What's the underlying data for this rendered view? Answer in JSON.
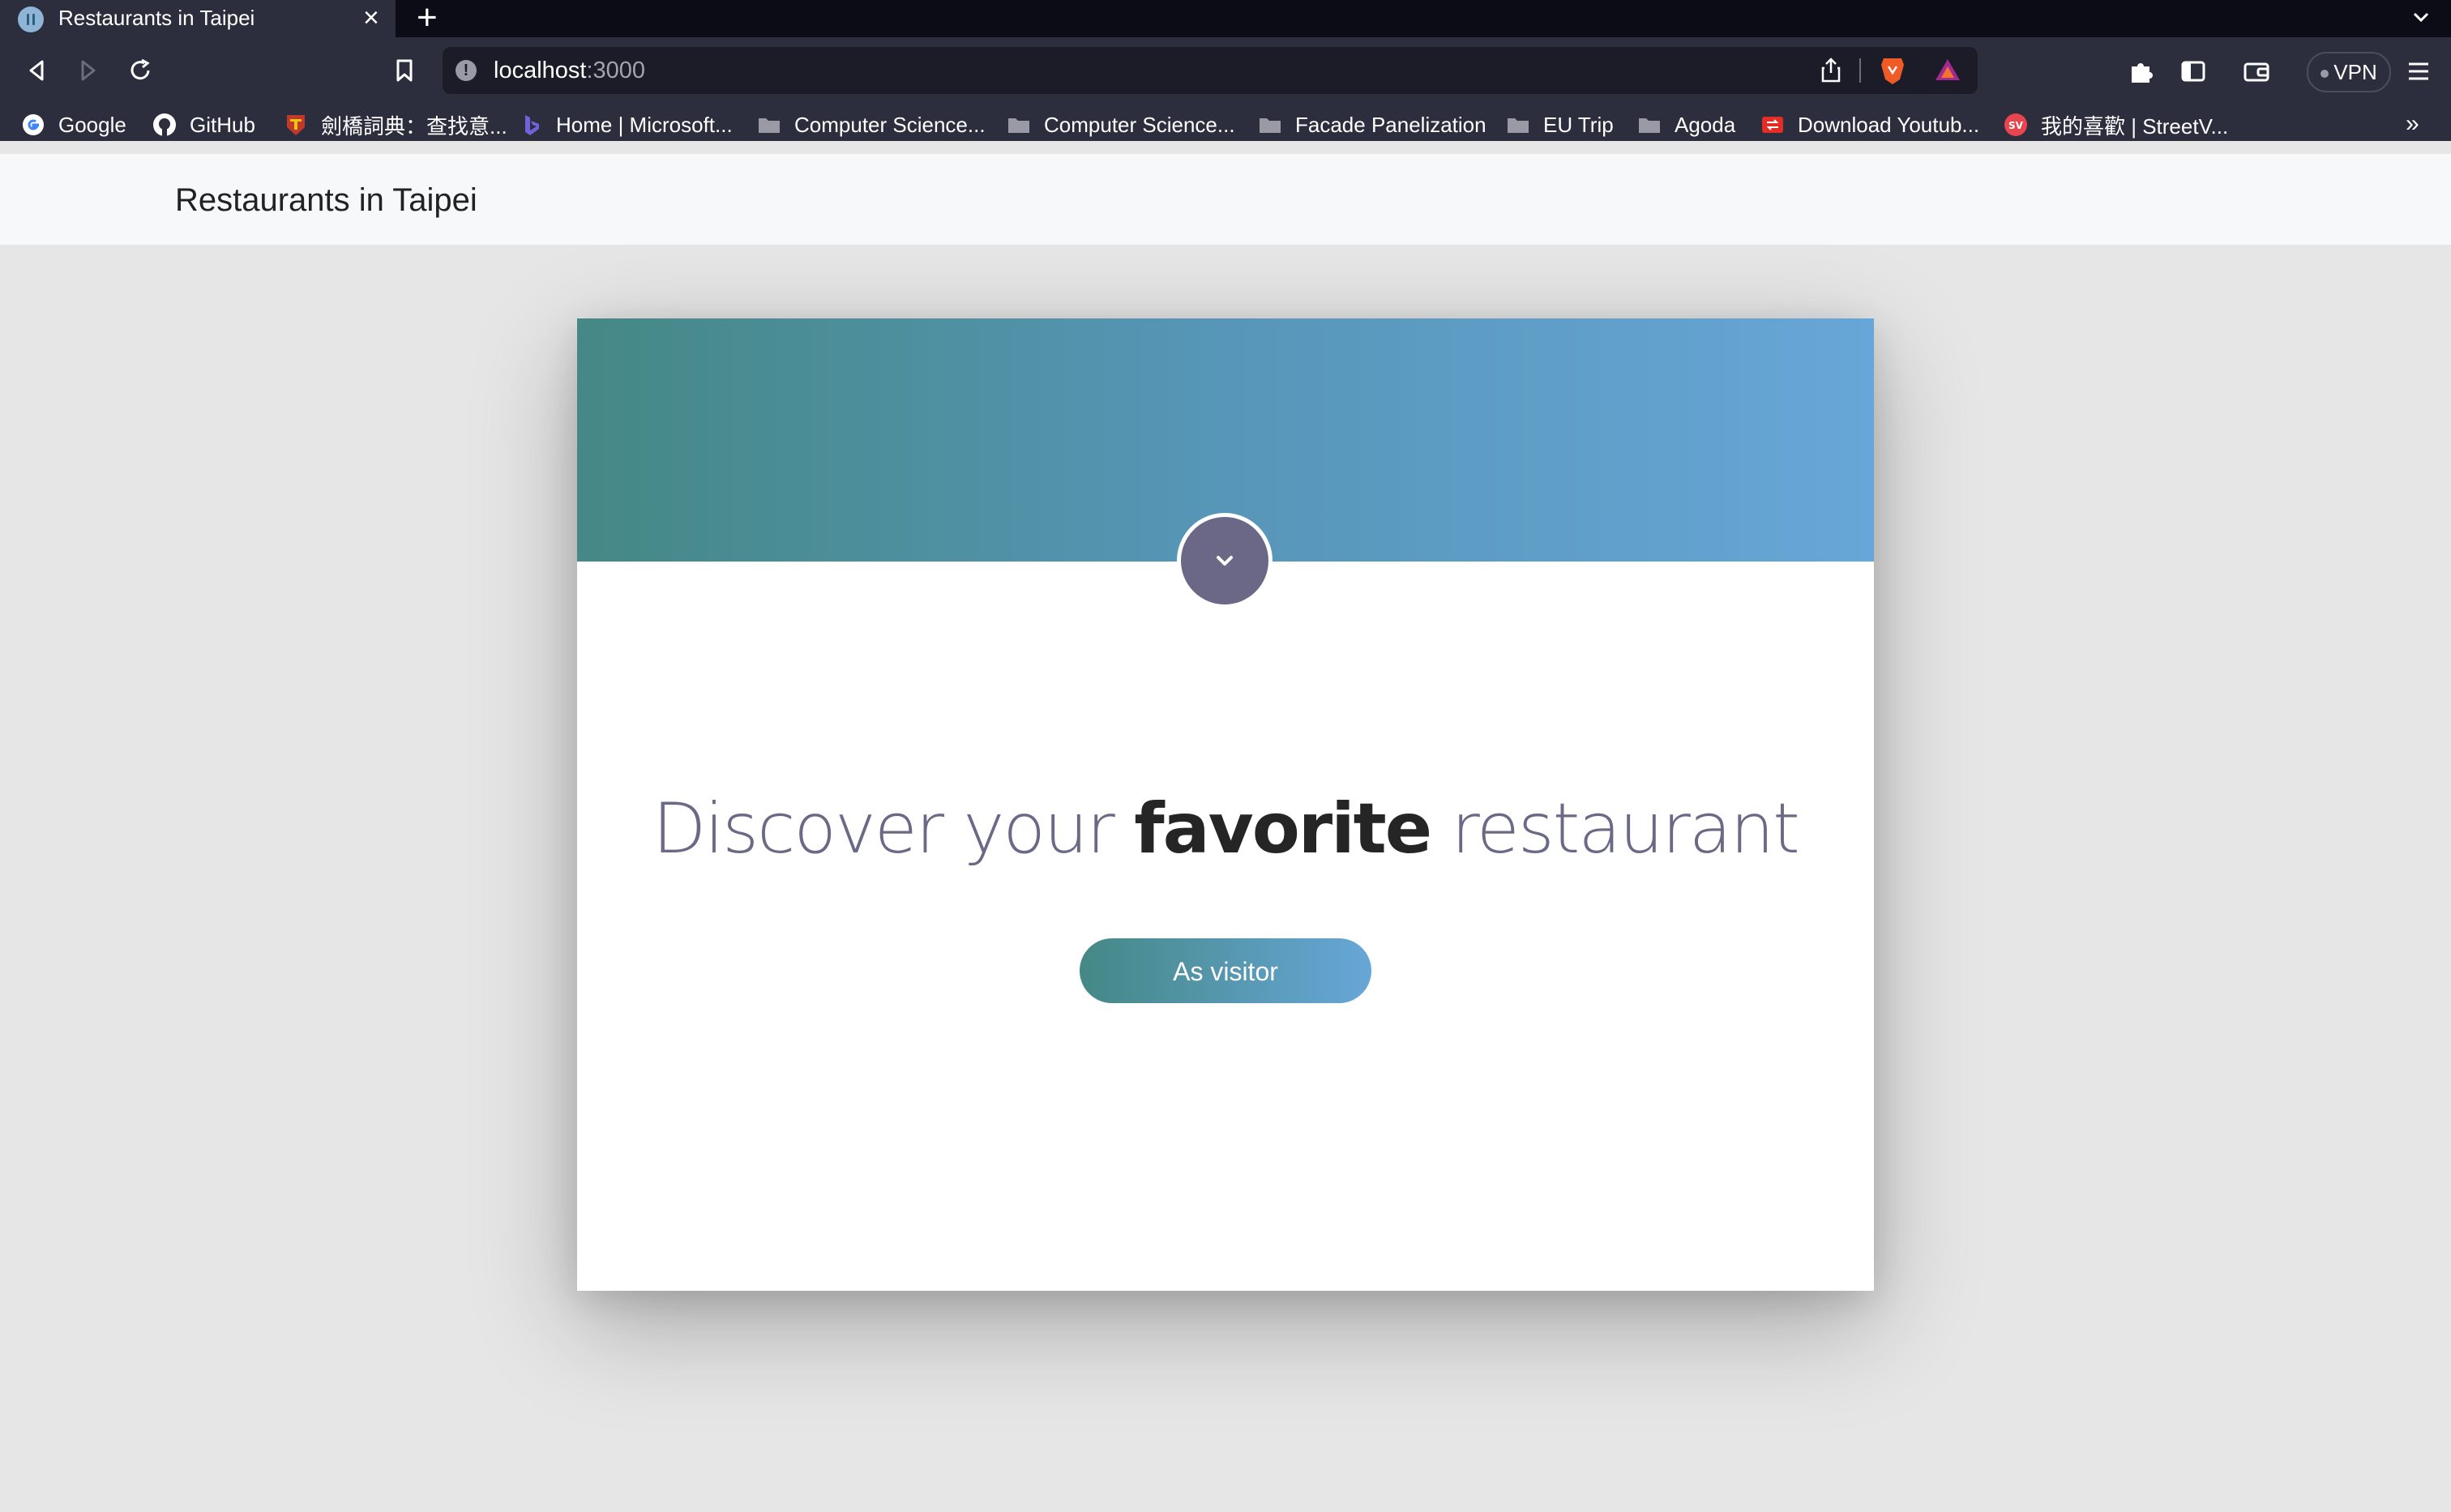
{
  "browser": {
    "tab_title": "Restaurants in Taipei",
    "url_host": "localhost",
    "url_port": ":3000",
    "vpn_label": "VPN",
    "bookmarks": [
      {
        "label": "Google",
        "icon": "google-icon"
      },
      {
        "label": "GitHub",
        "icon": "github-icon"
      },
      {
        "label": "劍橋詞典：查找意...",
        "icon": "cambridge-icon"
      },
      {
        "label": "Home | Microsoft...",
        "icon": "bing-icon"
      },
      {
        "label": "Computer Science...",
        "icon": "folder-icon"
      },
      {
        "label": "Computer Science...",
        "icon": "folder-icon"
      },
      {
        "label": "Facade Panelization",
        "icon": "folder-icon"
      },
      {
        "label": "EU Trip",
        "icon": "folder-icon"
      },
      {
        "label": "Agoda",
        "icon": "folder-icon"
      },
      {
        "label": "Download Youtub...",
        "icon": "download-icon"
      },
      {
        "label": "我的喜歡 | StreetV...",
        "icon": "streetvoice-icon"
      }
    ],
    "more_bookmarks": "»"
  },
  "page": {
    "brand": "Restaurants in Taipei",
    "headline_pre": "Discover your ",
    "headline_bold": "favorite",
    "headline_post": " restaurant",
    "visitor_button": "As visitor"
  },
  "colors": {
    "gradient_start": "#458885",
    "gradient_end": "#67a6d8",
    "chevron_bg": "#6b6887",
    "page_bg": "#e6e6e6"
  }
}
